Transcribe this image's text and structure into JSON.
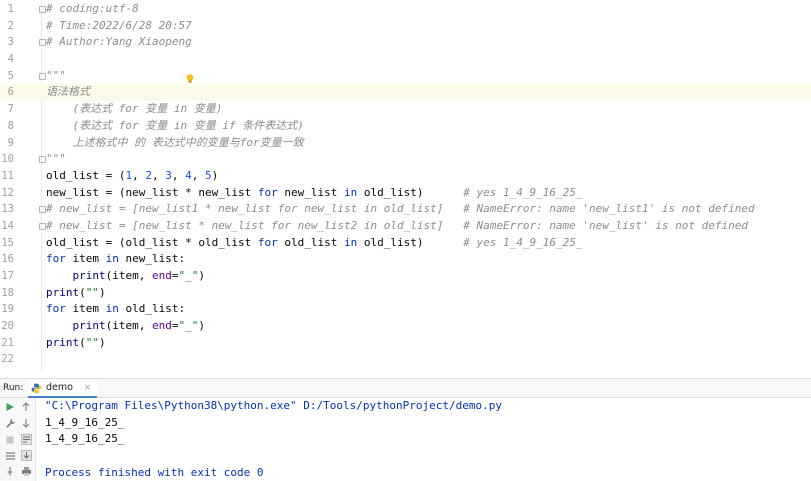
{
  "editor": {
    "current_line": 6,
    "lines": [
      {
        "n": "1",
        "fold": true,
        "segs": [
          {
            "c": "comment",
            "t": "# coding:utf-8"
          }
        ]
      },
      {
        "n": "2",
        "fold": false,
        "segs": [
          {
            "c": "comment",
            "t": "# Time:2022/6/28 20:57"
          }
        ]
      },
      {
        "n": "3",
        "fold": true,
        "segs": [
          {
            "c": "comment",
            "t": "# Author:Yang Xiaopeng"
          }
        ]
      },
      {
        "n": "4",
        "fold": false,
        "segs": []
      },
      {
        "n": "5",
        "fold": true,
        "segs": [
          {
            "c": "docstr",
            "t": "\"\"\""
          }
        ]
      },
      {
        "n": "6",
        "fold": false,
        "segs": [
          {
            "c": "docstr",
            "t": "语法格式"
          }
        ]
      },
      {
        "n": "7",
        "fold": false,
        "segs": [
          {
            "c": "docstr",
            "t": "    (表达式 for 变量 in 变量)"
          }
        ]
      },
      {
        "n": "8",
        "fold": false,
        "segs": [
          {
            "c": "docstr",
            "t": "    (表达式 for 变量 in 变量 if 条件表达式)"
          }
        ]
      },
      {
        "n": "9",
        "fold": false,
        "segs": [
          {
            "c": "docstr",
            "t": "    上述格式中 的 表达式中的变量与for变量一致"
          }
        ]
      },
      {
        "n": "10",
        "fold": true,
        "segs": [
          {
            "c": "docstr",
            "t": "\"\"\""
          }
        ]
      },
      {
        "n": "11",
        "fold": false,
        "segs": [
          {
            "c": "plain",
            "t": "old_list = ("
          },
          {
            "c": "num",
            "t": "1"
          },
          {
            "c": "plain",
            "t": ", "
          },
          {
            "c": "num",
            "t": "2"
          },
          {
            "c": "plain",
            "t": ", "
          },
          {
            "c": "num",
            "t": "3"
          },
          {
            "c": "plain",
            "t": ", "
          },
          {
            "c": "num",
            "t": "4"
          },
          {
            "c": "plain",
            "t": ", "
          },
          {
            "c": "num",
            "t": "5"
          },
          {
            "c": "plain",
            "t": ")"
          }
        ]
      },
      {
        "n": "12",
        "fold": false,
        "segs": [
          {
            "c": "plain",
            "t": "new_list = (new_list * new_list "
          },
          {
            "c": "kw",
            "t": "for"
          },
          {
            "c": "plain",
            "t": " new_list "
          },
          {
            "c": "kw",
            "t": "in"
          },
          {
            "c": "plain",
            "t": " old_list)      "
          },
          {
            "c": "comment",
            "t": "# yes 1_4_9_16_25_"
          }
        ]
      },
      {
        "n": "13",
        "fold": true,
        "segs": [
          {
            "c": "comment",
            "t": "# new_list = [new_list1 * new_list for new_list in old_list]   # NameError: name 'new_list1' is not defined"
          }
        ]
      },
      {
        "n": "14",
        "fold": true,
        "segs": [
          {
            "c": "comment",
            "t": "# new_list = [new_list * new_list for new_list2 in old_list]   # NameError: name 'new_list' is not defined"
          }
        ]
      },
      {
        "n": "15",
        "fold": false,
        "segs": [
          {
            "c": "plain",
            "t": "old_list = (old_list * old_list "
          },
          {
            "c": "kw",
            "t": "for"
          },
          {
            "c": "plain",
            "t": " old_list "
          },
          {
            "c": "kw",
            "t": "in"
          },
          {
            "c": "plain",
            "t": " old_list)      "
          },
          {
            "c": "comment",
            "t": "# yes 1_4_9_16_25_"
          }
        ]
      },
      {
        "n": "16",
        "fold": false,
        "segs": [
          {
            "c": "kw",
            "t": "for"
          },
          {
            "c": "plain",
            "t": " item "
          },
          {
            "c": "kw",
            "t": "in"
          },
          {
            "c": "plain",
            "t": " new_list:"
          }
        ]
      },
      {
        "n": "17",
        "fold": false,
        "segs": [
          {
            "c": "plain",
            "t": "    "
          },
          {
            "c": "builtin",
            "t": "print"
          },
          {
            "c": "plain",
            "t": "(item, "
          },
          {
            "c": "kwarg",
            "t": "end"
          },
          {
            "c": "plain",
            "t": "="
          },
          {
            "c": "str",
            "t": "\"_\""
          },
          {
            "c": "plain",
            "t": ")"
          }
        ]
      },
      {
        "n": "18",
        "fold": false,
        "segs": [
          {
            "c": "builtin",
            "t": "print"
          },
          {
            "c": "plain",
            "t": "("
          },
          {
            "c": "str",
            "t": "\"\""
          },
          {
            "c": "plain",
            "t": ")"
          }
        ]
      },
      {
        "n": "19",
        "fold": false,
        "segs": [
          {
            "c": "kw",
            "t": "for"
          },
          {
            "c": "plain",
            "t": " item "
          },
          {
            "c": "kw",
            "t": "in"
          },
          {
            "c": "plain",
            "t": " old_list:"
          }
        ]
      },
      {
        "n": "20",
        "fold": false,
        "segs": [
          {
            "c": "plain",
            "t": "    "
          },
          {
            "c": "builtin",
            "t": "print"
          },
          {
            "c": "plain",
            "t": "(item, "
          },
          {
            "c": "kwarg",
            "t": "end"
          },
          {
            "c": "plain",
            "t": "="
          },
          {
            "c": "str",
            "t": "\"_\""
          },
          {
            "c": "plain",
            "t": ")"
          }
        ]
      },
      {
        "n": "21",
        "fold": false,
        "segs": [
          {
            "c": "builtin",
            "t": "print"
          },
          {
            "c": "plain",
            "t": "("
          },
          {
            "c": "str",
            "t": "\"\""
          },
          {
            "c": "plain",
            "t": ")"
          }
        ]
      },
      {
        "n": "22",
        "fold": false,
        "segs": []
      }
    ]
  },
  "run_panel": {
    "label": "Run:",
    "tab_label": "demo",
    "tab_close": "×",
    "console": [
      {
        "kind": "cmd",
        "text": "\"C:\\Program Files\\Python38\\python.exe\" D:/Tools/pythonProject/demo.py"
      },
      {
        "kind": "out",
        "text": "1_4_9_16_25_"
      },
      {
        "kind": "out",
        "text": "1_4_9_16_25_"
      },
      {
        "kind": "out",
        "text": ""
      },
      {
        "kind": "fin",
        "text": "Process finished with exit code 0"
      }
    ]
  },
  "colors": {
    "comment": "#8c8c8c",
    "keyword": "#0033b3",
    "number": "#1750eb",
    "string": "#067d17",
    "kwarg": "#660099",
    "current_line": "#fcfae9",
    "run_tab_accent": "#4083c9",
    "run_icon": "#499c54"
  }
}
